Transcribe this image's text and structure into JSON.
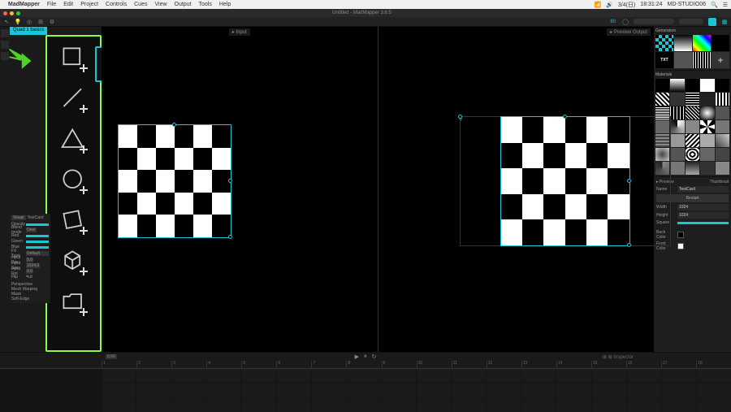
{
  "macos": {
    "app": "MadMapper",
    "menus": [
      "File",
      "Edit",
      "Project",
      "Controls",
      "Cues",
      "View",
      "Output",
      "Tools",
      "Help"
    ],
    "right": [
      "3/4(日)",
      "18:31:24",
      "MD-STUDIO06"
    ]
  },
  "window": {
    "title": "Untitled - MadMapper 3.6.5"
  },
  "toolbar": {
    "perf": "60"
  },
  "tabs": {
    "active": "Quad 1 basics"
  },
  "tools": [
    "quad",
    "line",
    "triangle",
    "circle",
    "mask",
    "3d",
    "folder"
  ],
  "viewports": {
    "left": "Input",
    "right": "Preview Output"
  },
  "props": {
    "tab1": "Visual",
    "tab2": "TestCard",
    "opacity": "Opacity",
    "blend": "Blend mode",
    "blendval": "Over",
    "red": "Red",
    "green": "Green",
    "blue": "Blue",
    "fxtype": "FX Type",
    "fxval": "Default",
    "ipos": "Input Pos",
    "iposval": "0,0",
    "isize": "Input Size",
    "isizeval": "1024,0",
    "irot": "Input Rot",
    "irotval": "0.0",
    "flip": "Flip",
    "persp": "Perspective",
    "mesh": "Mesh Warping",
    "mask": "Mask",
    "soft": "Soft-Edge"
  },
  "generators": {
    "title": "Generators",
    "items": [
      "TestCard",
      "Color",
      "TXT",
      "Solid Color",
      "Lines",
      "+"
    ]
  },
  "materials": {
    "title": "Materials"
  },
  "inspector": {
    "preview": "Preview",
    "thumb": "Thumbnail",
    "name_l": "Name",
    "name_v": "TestCard",
    "restart": "Restart",
    "width_l": "Width",
    "width_v": "1024",
    "height_l": "Height",
    "height_v": "1024",
    "square_l": "Square",
    "back_l": "Back Color",
    "front_l": "Front Color"
  },
  "timeline": {
    "marks": [
      "1",
      "2",
      "3",
      "4",
      "5",
      "6",
      "7",
      "8",
      "9",
      "10",
      "11",
      "12",
      "13",
      "14",
      "15",
      "16",
      "17",
      "18"
    ],
    "time": "0.00"
  },
  "chart_data": {
    "type": "table",
    "title": "UI editor with two checkerboard surfaces (Input & Preview)",
    "note": "Checkerboard 6x5 pattern, selection handles at edges, tool palette highlighted in green"
  }
}
